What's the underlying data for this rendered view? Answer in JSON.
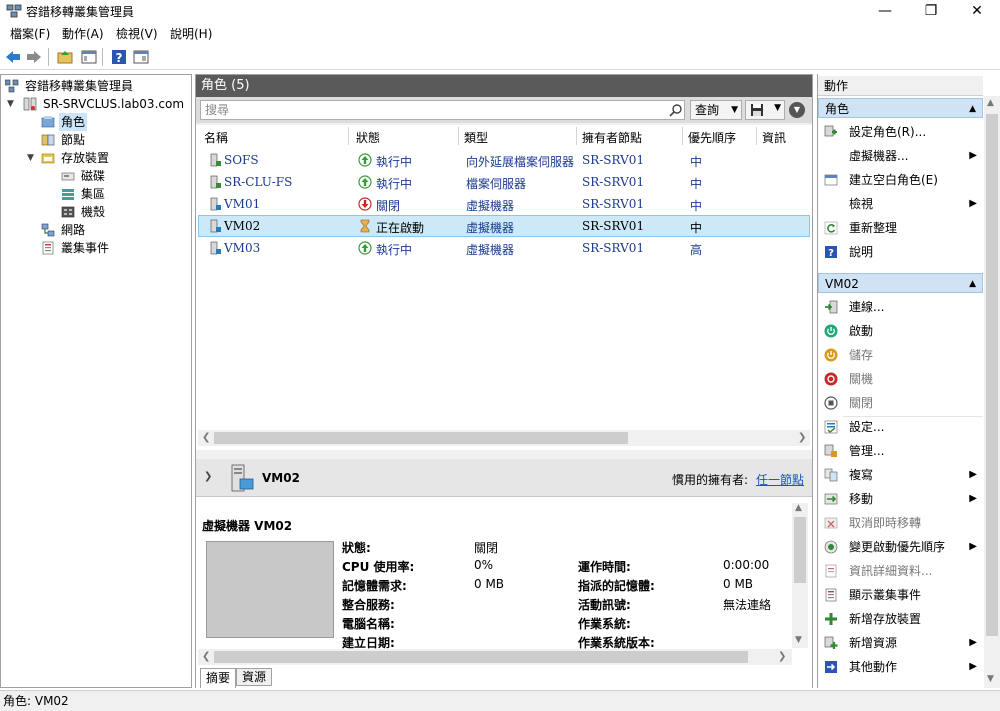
{
  "window": {
    "title": "容錯移轉叢集管理員"
  },
  "menu": [
    "檔案(F)",
    "動作(A)",
    "檢視(V)",
    "說明(H)"
  ],
  "tree": {
    "root": "容錯移轉叢集管理員",
    "cluster": "SR-SRVCLUS.lab03.com",
    "items": [
      "角色",
      "節點",
      "存放裝置",
      "磁碟",
      "集區",
      "機殼",
      "網路",
      "叢集事件"
    ]
  },
  "roles": {
    "header": "角色 (5)",
    "search_placeholder": "搜尋",
    "query_label": "查詢",
    "columns": [
      "名稱",
      "狀態",
      "類型",
      "擁有者節點",
      "優先順序",
      "資訊"
    ],
    "rows": [
      {
        "name": "SOFS",
        "status": "執行中",
        "type": "向外延展檔案伺服器",
        "owner": "SR-SRV01",
        "priority": "中"
      },
      {
        "name": "SR-CLU-FS",
        "status": "執行中",
        "type": "檔案伺服器",
        "owner": "SR-SRV01",
        "priority": "中"
      },
      {
        "name": "VM01",
        "status": "關閉",
        "type": "虛擬機器",
        "owner": "SR-SRV01",
        "priority": "中"
      },
      {
        "name": "VM02",
        "status": "正在啟動",
        "type": "虛擬機器",
        "owner": "SR-SRV01",
        "priority": "中"
      },
      {
        "name": "VM03",
        "status": "執行中",
        "type": "虛擬機器",
        "owner": "SR-SRV01",
        "priority": "高"
      }
    ]
  },
  "detail": {
    "name": "VM02",
    "preferred_owner_label": "慣用的擁有者:",
    "preferred_owner_link": "任一節點",
    "section_title": "虛擬機器 VM02",
    "left": [
      {
        "label": "狀態:",
        "value": "關閉"
      },
      {
        "label": "CPU 使用率:",
        "value": "0%"
      },
      {
        "label": "記憶體需求:",
        "value": "0 MB"
      },
      {
        "label": "整合服務:",
        "value": ""
      },
      {
        "label": "電腦名稱:",
        "value": ""
      },
      {
        "label": "建立日期:",
        "value": ""
      }
    ],
    "right": [
      {
        "label": "運作時間:",
        "value": "0:00:00"
      },
      {
        "label": "指派的記憶體:",
        "value": "0 MB"
      },
      {
        "label": "活動訊號:",
        "value": "無法連絡"
      },
      {
        "label": "作業系統:",
        "value": ""
      },
      {
        "label": "作業系統版本:",
        "value": ""
      }
    ],
    "tabs": [
      "摘要",
      "資源"
    ]
  },
  "actions": {
    "title": "動作",
    "group1": "角色",
    "group1_items": [
      "設定角色(R)...",
      "虛擬機器...",
      "建立空白角色(E)",
      "檢視",
      "重新整理",
      "說明"
    ],
    "group2": "VM02",
    "group2_items": [
      "連線...",
      "啟動",
      "儲存",
      "關機",
      "關閉",
      "設定...",
      "管理...",
      "複寫",
      "移動",
      "取消即時移轉",
      "變更啟動優先順序",
      "資訊詳細資料...",
      "顯示叢集事件",
      "新增存放裝置",
      "新增資源",
      "其他動作"
    ]
  },
  "statusbar": {
    "text": "角色: VM02"
  }
}
